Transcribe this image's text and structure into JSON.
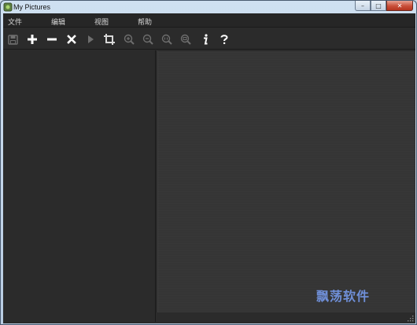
{
  "window": {
    "title": "My Pictures",
    "minimize_glyph": "–",
    "maximize_glyph": "□",
    "close_glyph": "✕"
  },
  "menubar": {
    "items": [
      {
        "label": "文件"
      },
      {
        "label": "编辑"
      },
      {
        "label": "视图"
      },
      {
        "label": "帮助"
      }
    ]
  },
  "toolbar": {
    "tools": [
      {
        "icon": "save-icon",
        "enabled": false
      },
      {
        "icon": "add-icon",
        "enabled": true
      },
      {
        "icon": "remove-icon",
        "enabled": true
      },
      {
        "icon": "delete-icon",
        "enabled": true
      },
      {
        "icon": "play-icon",
        "enabled": false
      },
      {
        "icon": "crop-icon",
        "enabled": true
      },
      {
        "icon": "zoom-in-icon",
        "enabled": false
      },
      {
        "icon": "zoom-out-icon",
        "enabled": false
      },
      {
        "icon": "zoom-actual-icon",
        "enabled": false
      },
      {
        "icon": "zoom-fit-icon",
        "enabled": false
      },
      {
        "icon": "info-icon",
        "enabled": true
      },
      {
        "icon": "help-icon",
        "enabled": true
      }
    ]
  },
  "watermark": {
    "text": "飘荡软件"
  },
  "colors": {
    "background": "#2a2a2a",
    "viewer": "#353535",
    "icon_enabled": "#ffffff",
    "icon_disabled": "#6e6e6e",
    "watermark": "#6f8fd8"
  }
}
